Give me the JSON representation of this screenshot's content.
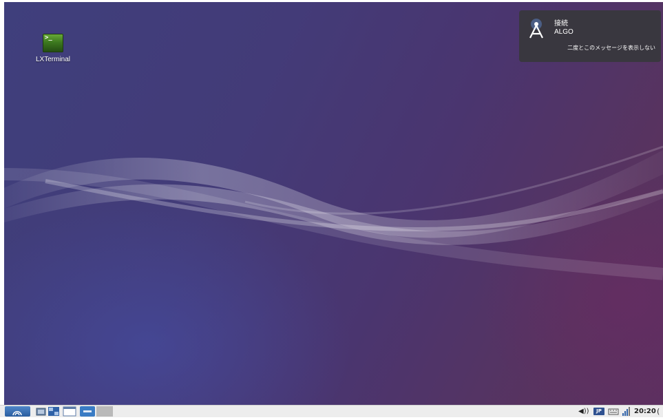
{
  "desktop": {
    "icons": [
      {
        "label": "LXTerminal",
        "glyph": ">_"
      }
    ]
  },
  "notification": {
    "title": "接続",
    "body": "ALGO",
    "action": "二度とこのメッセージを表示しない",
    "icon": "antenna-icon"
  },
  "taskbar": {
    "menu_icon": "lubuntu-logo-icon",
    "launchers": [
      "file-manager-icon",
      "task-window-icon",
      "browser-window-icon"
    ],
    "tasks": [
      "window-task-icon"
    ],
    "tray": {
      "volume": "◀))",
      "keyboard_layout": "JP",
      "keyboard_icon": "keyboard-icon",
      "network_icon": "signal-bars-icon",
      "clock": "20:20",
      "power_glyph": "("
    }
  },
  "colors": {
    "wallpaper_dark": "#3f3f7c",
    "wallpaper_purple": "#5c3060",
    "notification_bg": "#37373c",
    "taskbar_bg": "#ededed",
    "accent_blue": "#3a7cc4"
  }
}
